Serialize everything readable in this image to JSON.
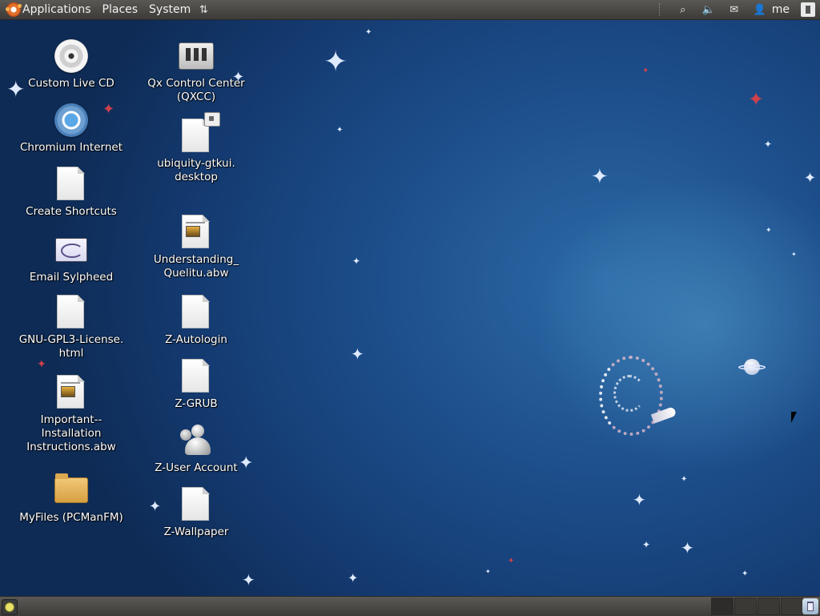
{
  "top_panel": {
    "menus": [
      "Applications",
      "Places",
      "System"
    ],
    "user_name": "me"
  },
  "tray_icons": [
    "network-icon",
    "volume-icon",
    "mail-icon",
    "user-icon",
    "shutdown-icon"
  ],
  "desktop_icons_col1": [
    {
      "label": "Custom Live CD",
      "icon": "cd-icon"
    },
    {
      "label": "Chromium Internet",
      "icon": "chromium-icon"
    },
    {
      "label": "Create Shortcuts",
      "icon": "document-icon"
    },
    {
      "label": "Email  Sylpheed",
      "icon": "sylpheed-icon"
    },
    {
      "label": "GNU-GPL3-License.\nhtml",
      "icon": "document-icon"
    },
    {
      "label": "Important--\nInstallation\nInstructions.abw",
      "icon": "abw-document-icon"
    },
    {
      "label": "MyFiles  (PCManFM)",
      "icon": "folder-icon"
    }
  ],
  "desktop_icons_col2": [
    {
      "label": "Qx Control Center\n(QXCC)",
      "icon": "control-center-icon"
    },
    {
      "label": "ubiquity-gtkui.\ndesktop",
      "icon": "locked-document-icon"
    },
    {
      "label": "Understanding_\nQuelitu.abw",
      "icon": "abw-document-icon"
    },
    {
      "label": "Z-Autologin",
      "icon": "document-icon"
    },
    {
      "label": "Z-GRUB",
      "icon": "document-icon"
    },
    {
      "label": "Z-User Account",
      "icon": "users-icon"
    },
    {
      "label": "Z-Wallpaper",
      "icon": "document-icon"
    }
  ],
  "bottom_panel": {
    "workspaces": 4,
    "active_workspace": 1
  },
  "colors": {
    "panel": "#4a4845",
    "desktop_blue": "#1d4f8c",
    "star_red": "#d0404a"
  }
}
